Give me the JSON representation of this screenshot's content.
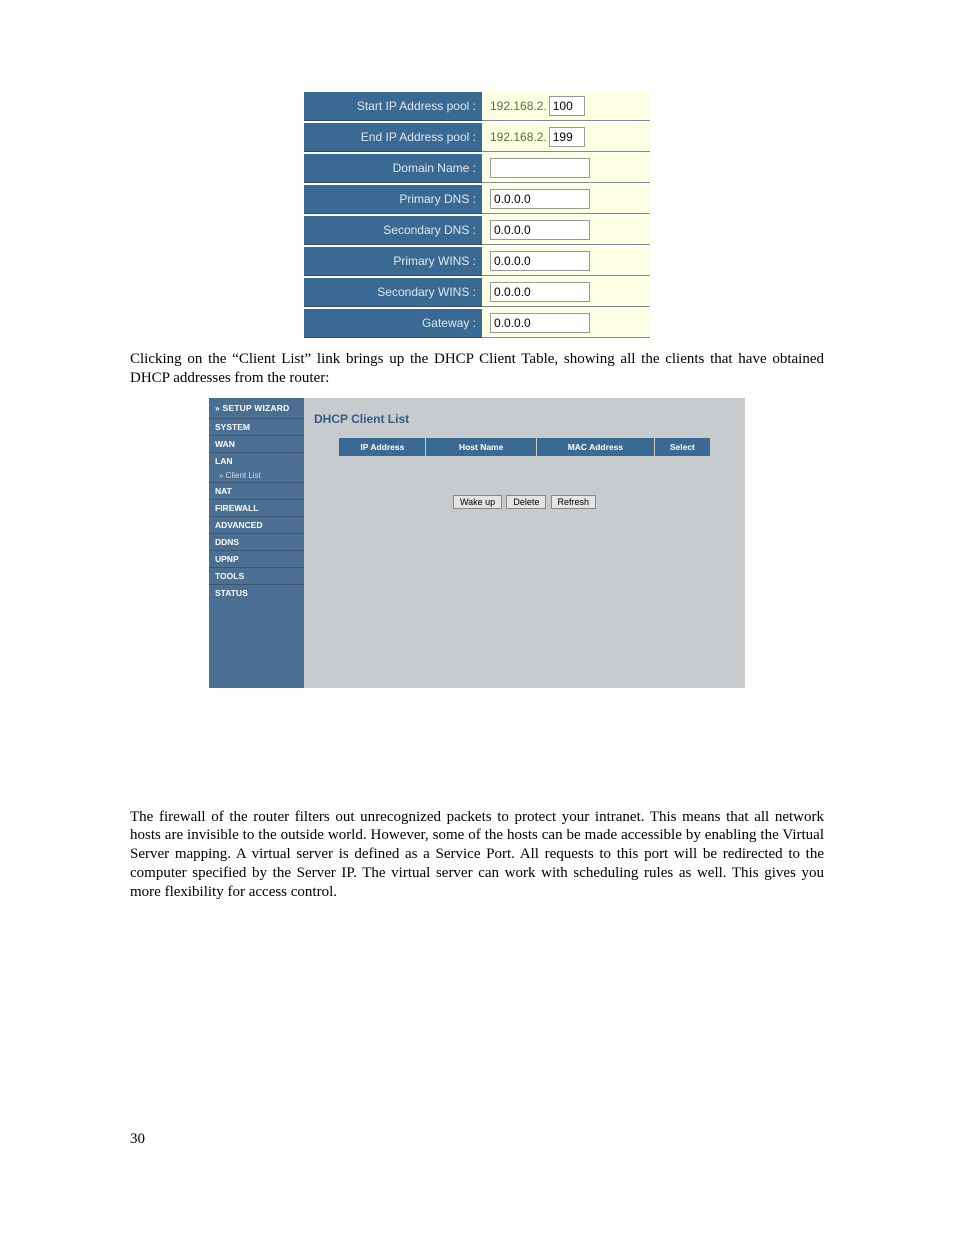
{
  "settings": {
    "rows": [
      {
        "label": "Start IP Address pool :",
        "prefix": "192.168.2.",
        "value": "100",
        "cls": "small"
      },
      {
        "label": "End IP Address pool :",
        "prefix": "192.168.2.",
        "value": "199",
        "cls": "small"
      },
      {
        "label": "Domain Name :",
        "prefix": "",
        "value": "",
        "cls": "wide"
      },
      {
        "label": "Primary DNS :",
        "prefix": "",
        "value": "0.0.0.0",
        "cls": "wide"
      },
      {
        "label": "Secondary DNS :",
        "prefix": "",
        "value": "0.0.0.0",
        "cls": "wide"
      },
      {
        "label": "Primary WINS :",
        "prefix": "",
        "value": "0.0.0.0",
        "cls": "wide"
      },
      {
        "label": "Secondary WINS :",
        "prefix": "",
        "value": "0.0.0.0",
        "cls": "wide"
      },
      {
        "label": "Gateway :",
        "prefix": "",
        "value": "0.0.0.0",
        "cls": "wide"
      }
    ]
  },
  "para1": "Clicking on the “Client List” link brings up the DHCP Client Table, showing all the clients that have obtained DHCP addresses from the router:",
  "router": {
    "wizard": "» SETUP WIZARD",
    "nav": [
      {
        "label": "SYSTEM"
      },
      {
        "label": "WAN"
      },
      {
        "label": "LAN",
        "sub": [
          "» Client List"
        ]
      },
      {
        "label": "NAT"
      },
      {
        "label": "FIREWALL"
      },
      {
        "label": "ADVANCED"
      },
      {
        "label": "DDNS"
      },
      {
        "label": "UPnP"
      },
      {
        "label": "TOOLS"
      },
      {
        "label": "STATUS"
      }
    ],
    "title": "DHCP Client List",
    "columns": [
      "IP Address",
      "Host Name",
      "MAC Address",
      "Select"
    ],
    "buttons": {
      "wake": "Wake up",
      "delete": "Delete",
      "refresh": "Refresh"
    }
  },
  "para2": "The firewall of the router filters out unrecognized packets to protect your intranet. This means that all network hosts are invisible to the outside world. However, some of the hosts can be made accessible by enabling the Virtual Server mapping. A virtual server is defined as a Service Port. All requests to this port will be redirected to the computer specified by the Server IP. The virtual server can work with scheduling rules as well. This gives you more flexibility for access control.",
  "page_number": "30"
}
